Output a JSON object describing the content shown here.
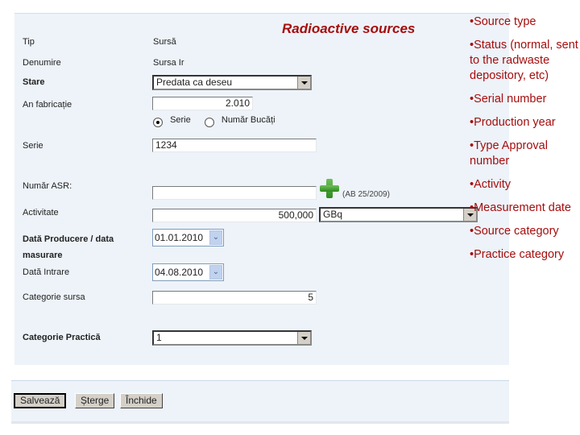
{
  "form": {
    "title": "Radioactive sources",
    "fields": {
      "tip": {
        "label": "Tip",
        "value": "Sursă"
      },
      "denumire": {
        "label": "Denumire",
        "value": "Sursa Ir"
      },
      "stare": {
        "label": "Stare",
        "value": "Predata ca deseu"
      },
      "an_fabricatie": {
        "label": "An fabricație",
        "value": "2.010"
      },
      "mode_radio": {
        "option_serie": "Serie",
        "option_numar": "Număr Bucăți",
        "selected": "Serie"
      },
      "serie": {
        "label": "Serie",
        "value": "1234"
      },
      "numar_asr": {
        "label": "Număr ASR:",
        "value": "",
        "note": "(AB 25/2009)"
      },
      "activitate": {
        "label": "Activitate",
        "value": "500,000",
        "unit": "GBq"
      },
      "data_producere": {
        "label": "Dată Producere / data masurare",
        "value": "01.01.2010"
      },
      "data_intrare": {
        "label": "Dată Intrare",
        "value": "04.08.2010"
      },
      "categorie_sursa": {
        "label": "Categorie sursa",
        "value": "5"
      },
      "categorie_practica": {
        "label": "Categorie Practică",
        "value": "1"
      }
    },
    "buttons": {
      "save": "Salvează",
      "delete": "Șterge",
      "close": "Închide"
    }
  },
  "notes": [
    "•Source type",
    "•Status (normal, sent to the radwaste depository, etc)",
    "•Serial number",
    "•Production year",
    "•Type Approval number",
    "•Activity",
    "•Measurement date",
    "•Source category",
    "•Practice category"
  ],
  "colors": {
    "accent": "#a50d0d",
    "panel": "#edf3f9"
  }
}
